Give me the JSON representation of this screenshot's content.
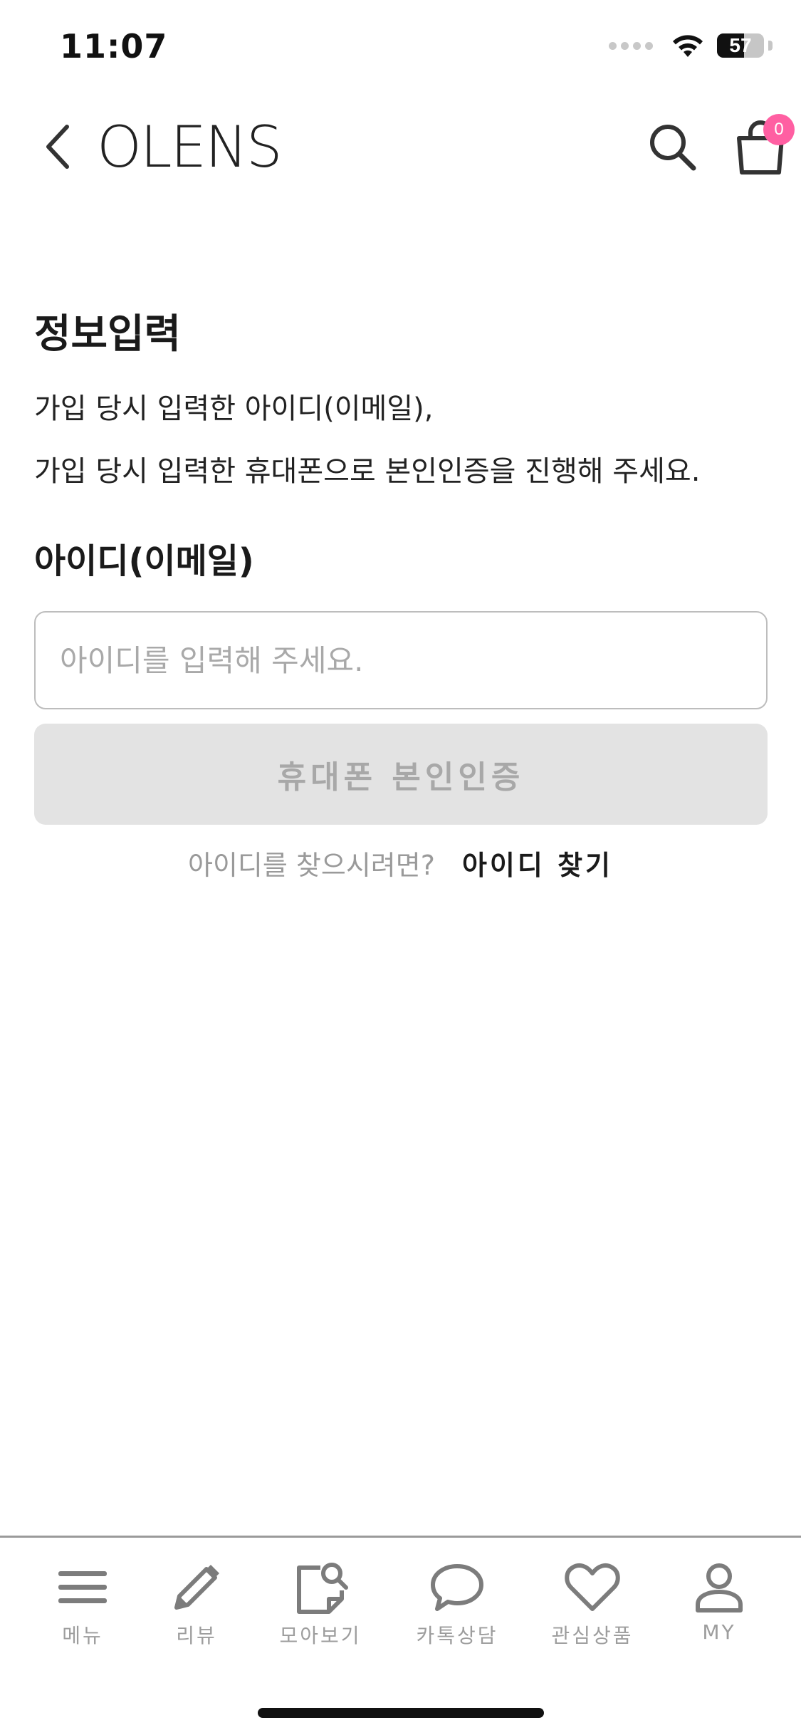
{
  "status_bar": {
    "time": "11:07",
    "battery": "57",
    "battery_level": 0.57
  },
  "header": {
    "brand": "OLENS",
    "cart_count": "0"
  },
  "content": {
    "title": "정보입력",
    "description_lines": [
      "가입 당시 입력한 아이디(이메일),",
      "가입 당시 입력한 휴대폰으로 본인인증을 진행해 주세요."
    ],
    "id_label": "아이디(이메일)",
    "id_value": "",
    "id_placeholder": "아이디를 입력해 주세요.",
    "verify_button": "휴대폰 본인인증",
    "find_hint": "아이디를 찾으시려면?",
    "find_link": "아이디 찾기"
  },
  "tab_bar": {
    "items": [
      {
        "label": "메뉴",
        "icon": "menu-icon"
      },
      {
        "label": "리뷰",
        "icon": "pencil-icon"
      },
      {
        "label": "모아보기",
        "icon": "collection-search-icon"
      },
      {
        "label": "카톡상담",
        "icon": "chat-bubble-icon"
      },
      {
        "label": "관심상품",
        "icon": "heart-icon"
      },
      {
        "label": "MY",
        "icon": "person-icon"
      }
    ]
  },
  "colors": {
    "badge": "#ff5fa2",
    "button_disabled_bg": "#e3e3e3",
    "button_disabled_text": "#a8a8a8",
    "tab_icon": "#7c7c7c"
  }
}
